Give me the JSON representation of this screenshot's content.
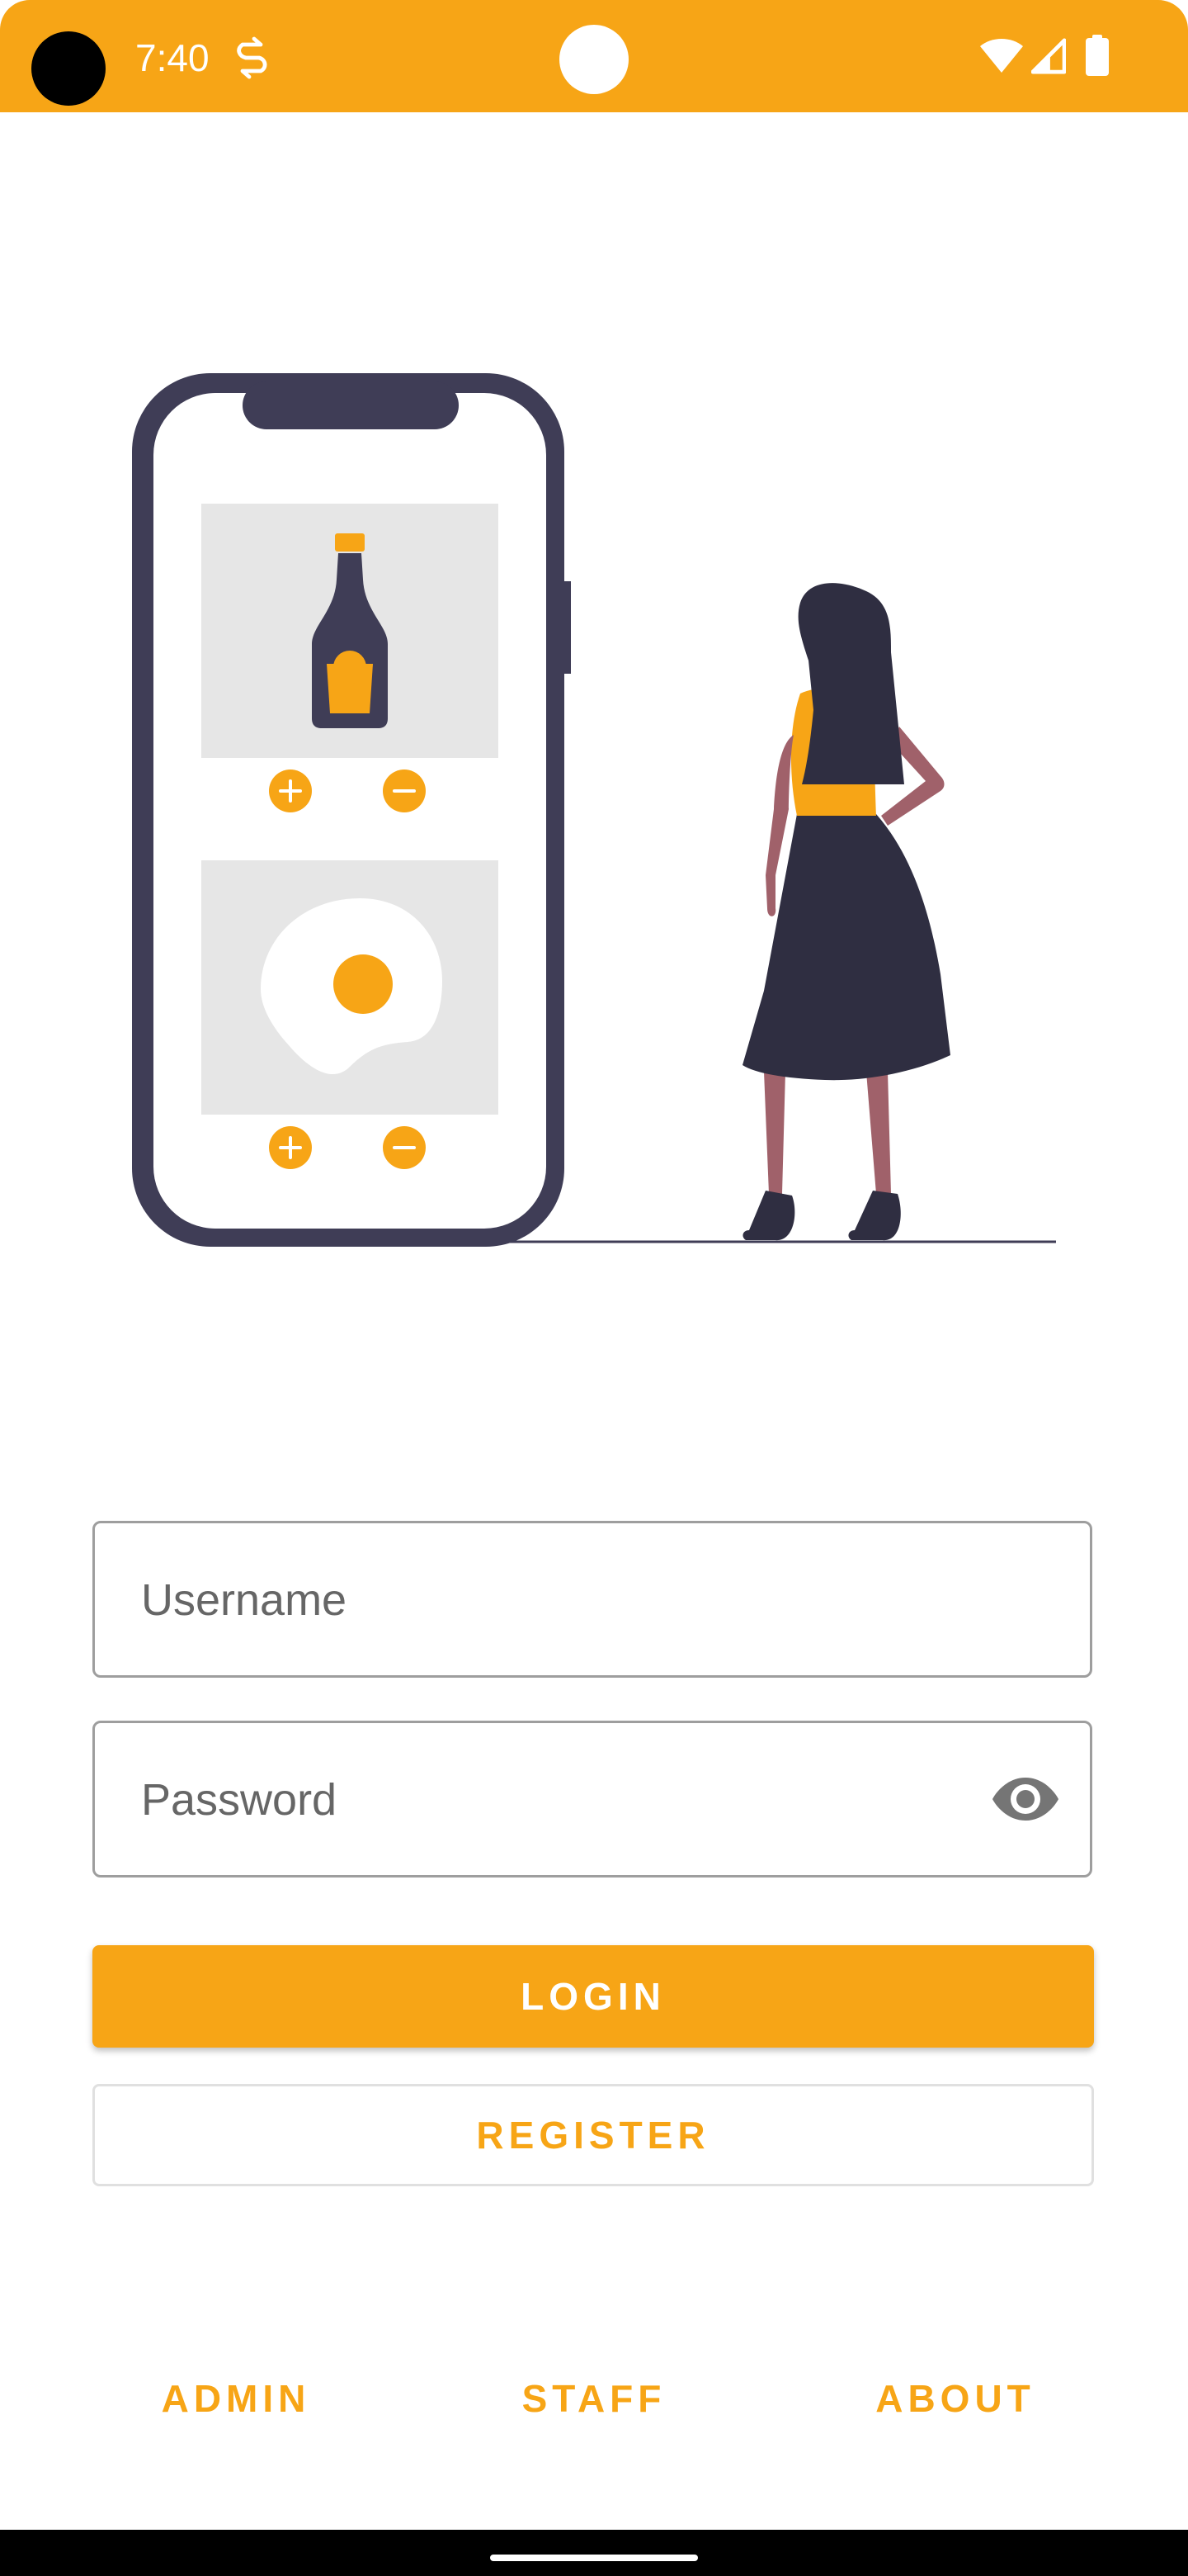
{
  "status_bar": {
    "time": "7:40",
    "color": "#F7A516",
    "icons": [
      "sync-icon",
      "wifi-icon",
      "signal-icon",
      "battery-icon"
    ]
  },
  "illustration": {
    "description_icon": "woman-with-phone-illustration",
    "product_icons": [
      "sauce-bottle-icon",
      "fried-egg-icon"
    ],
    "controls": [
      "plus-icon",
      "minus-icon"
    ]
  },
  "form": {
    "username_placeholder": "Username",
    "username_value": "",
    "password_placeholder": "Password",
    "password_value": ""
  },
  "buttons": {
    "login": "LOGIN",
    "register": "REGISTER"
  },
  "footer_links": {
    "admin": "ADMIN",
    "staff": "STAFF",
    "about": "ABOUT"
  },
  "colors": {
    "accent": "#F7A516",
    "dark": "#3F3D56",
    "skin": "#A0616A",
    "light_gray": "#E6E6E6"
  }
}
